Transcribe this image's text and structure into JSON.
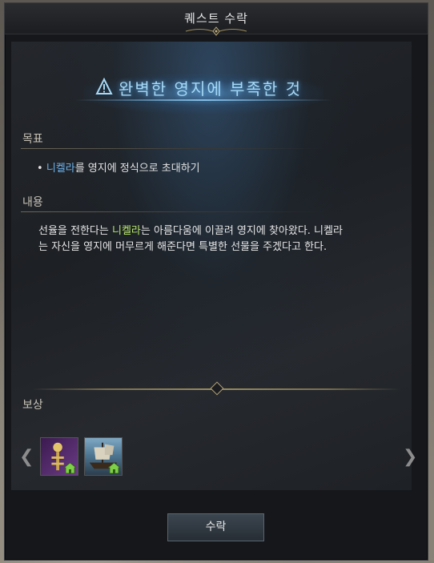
{
  "window": {
    "title": "퀘스트 수락"
  },
  "quest": {
    "icon": "quest-alert-icon",
    "title": "완벽한 영지에 부족한 것"
  },
  "objective": {
    "label": "목표",
    "bullet": "•",
    "npc": "니켈라",
    "rest": "를 영지에 정식으로 초대하기"
  },
  "content": {
    "label": "내용",
    "part1": "선율을 전한다는 ",
    "npc": "니켈라",
    "part2": "는 아름다움에 이끌려 영지에 찾아왔다. 니켈라",
    "line2": "는 자신을 영지에 머무르게 해준다면 특별한 선물을 주겠다고 한다."
  },
  "reward": {
    "label": "보상",
    "items": [
      {
        "icon": "lantern-item-icon"
      },
      {
        "icon": "ship-item-icon"
      }
    ]
  },
  "buttons": {
    "accept": "수락"
  },
  "colors": {
    "npc_blue": "#6fb3ec",
    "npc_green": "#b9e86a",
    "title_blue": "#a6d8f5"
  }
}
